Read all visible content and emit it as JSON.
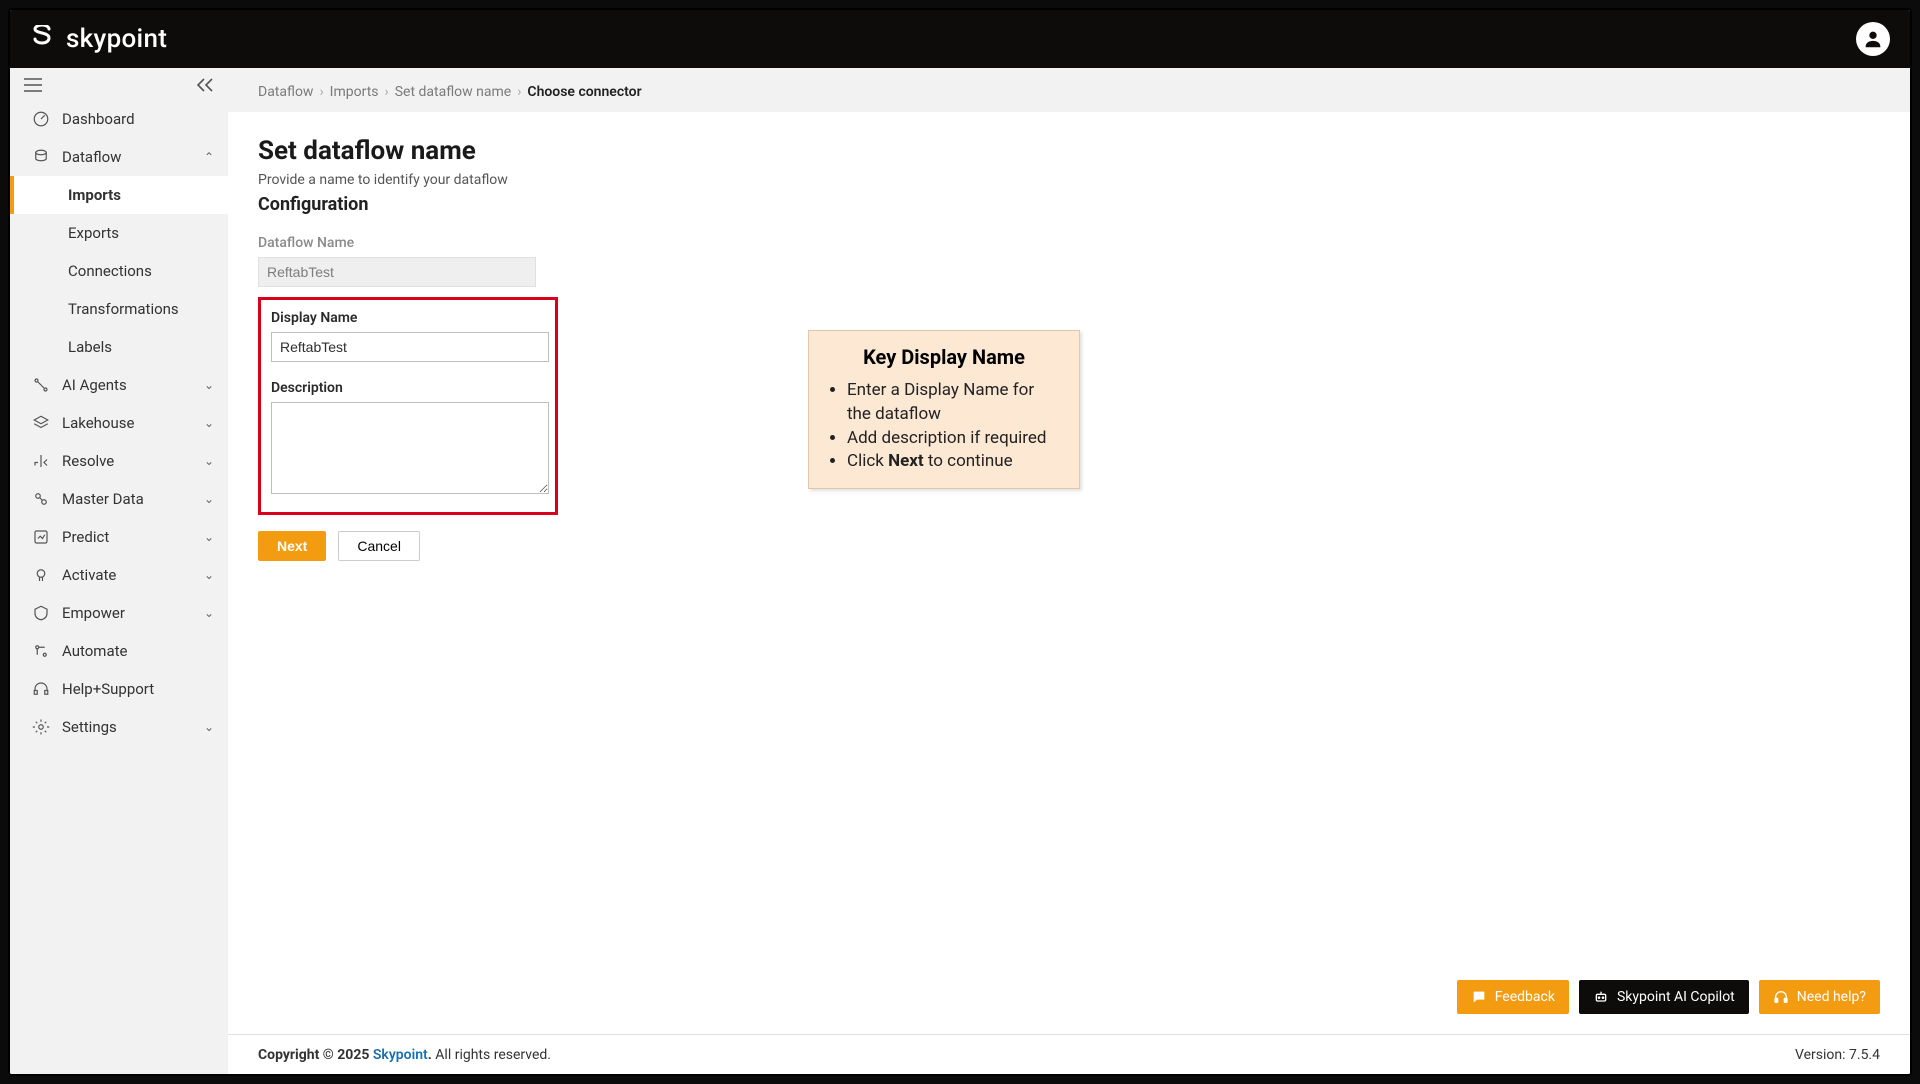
{
  "brand": "skypoint",
  "breadcrumb": [
    "Dataflow",
    "Imports",
    "Set dataflow name",
    "Choose connector"
  ],
  "sidebar": {
    "items": [
      {
        "label": "Dashboard",
        "expandable": false
      },
      {
        "label": "Dataflow",
        "expandable": true,
        "open": true,
        "children": [
          "Imports",
          "Exports",
          "Connections",
          "Transformations",
          "Labels"
        ],
        "active_child": 0
      },
      {
        "label": "AI Agents",
        "expandable": true
      },
      {
        "label": "Lakehouse",
        "expandable": true
      },
      {
        "label": "Resolve",
        "expandable": true
      },
      {
        "label": "Master Data",
        "expandable": true
      },
      {
        "label": "Predict",
        "expandable": true
      },
      {
        "label": "Activate",
        "expandable": true
      },
      {
        "label": "Empower",
        "expandable": true
      },
      {
        "label": "Automate",
        "expandable": false
      },
      {
        "label": "Help+Support",
        "expandable": false
      },
      {
        "label": "Settings",
        "expandable": true
      }
    ]
  },
  "page": {
    "title": "Set dataflow name",
    "subtitle": "Provide a name to identify your dataflow",
    "section": "Configuration",
    "fields": {
      "dataflow_name_label": "Dataflow Name",
      "dataflow_name_value": "ReftabTest",
      "display_name_label": "Display Name",
      "display_name_value": "ReftabTest",
      "description_label": "Description",
      "description_value": ""
    },
    "buttons": {
      "next": "Next",
      "cancel": "Cancel"
    }
  },
  "callout": {
    "title": "Key Display Name",
    "bullets": [
      "Enter a Display Name for the dataflow",
      "Add description if required",
      "Click Next to continue"
    ]
  },
  "footer_chips": {
    "feedback": "Feedback",
    "copilot": "Skypoint AI Copilot",
    "help": "Need help?"
  },
  "footer": {
    "copyright_prefix": "Copyright © 2025 ",
    "brand": "Skypoint",
    "copyright_suffix": ". All rights reserved.",
    "version": "Version: 7.5.4"
  }
}
